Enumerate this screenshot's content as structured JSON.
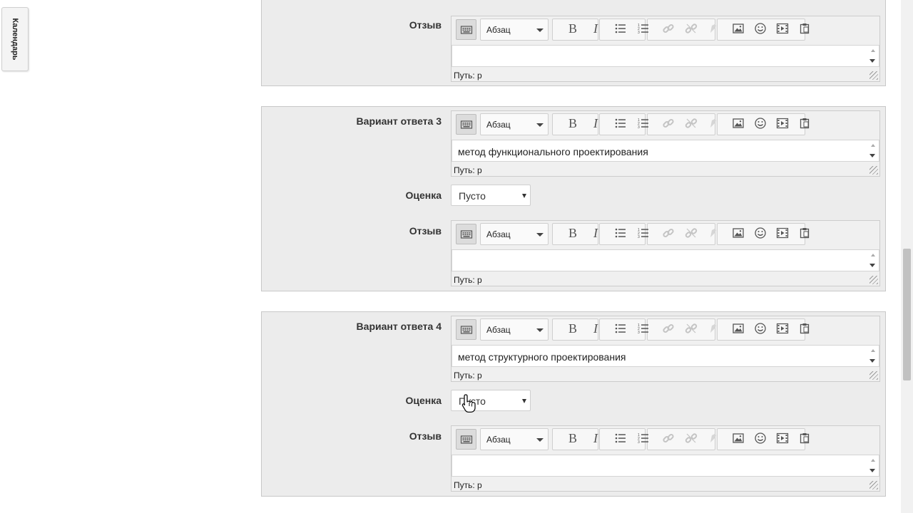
{
  "calendar_tab": {
    "label": "Календарь"
  },
  "labels": {
    "feedback": "Отзыв",
    "grade": "Оценка",
    "answer3": "Вариант ответа 3",
    "answer4": "Вариант ответа 4"
  },
  "editor": {
    "format_label": "Абзац",
    "path_label": "Путь: p",
    "icons": [
      "keyboard-toggle-icon",
      "bold-icon",
      "italic-icon",
      "unordered-list-icon",
      "ordered-list-icon",
      "link-icon",
      "unlink-icon",
      "anchor-icon",
      "image-icon",
      "emoticon-icon",
      "media-icon",
      "paste-icon"
    ]
  },
  "answers": [
    {
      "text": "метод функционального проектирования",
      "grade": "Пусто",
      "feedback": ""
    },
    {
      "text": "метод структурного проектирования",
      "grade": "Пусто",
      "feedback": ""
    }
  ],
  "colors": {
    "box_bg": "#ececec",
    "border": "#c8c8c8",
    "icon": "#555555",
    "icon_disabled": "#c4c4c4"
  }
}
